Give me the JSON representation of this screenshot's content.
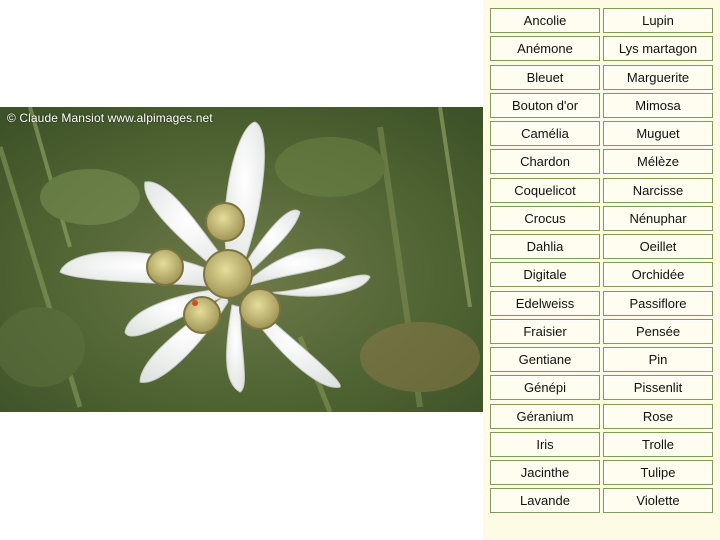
{
  "photo": {
    "credit": "© Claude Mansiot www.alpimages.net",
    "alt": "Edelweiss"
  },
  "flowers": [
    {
      "left": "Ancolie",
      "right": "Lupin"
    },
    {
      "left": "Anémone",
      "right": "Lys martagon"
    },
    {
      "left": "Bleuet",
      "right": "Marguerite"
    },
    {
      "left": "Bouton d'or",
      "right": "Mimosa"
    },
    {
      "left": "Camélia",
      "right": "Muguet"
    },
    {
      "left": "Chardon",
      "right": "Mélèze"
    },
    {
      "left": "Coquelicot",
      "right": "Narcisse"
    },
    {
      "left": "Crocus",
      "right": "Nénuphar"
    },
    {
      "left": "Dahlia",
      "right": "Oeillet"
    },
    {
      "left": "Digitale",
      "right": "Orchidée"
    },
    {
      "left": "Edelweiss",
      "right": "Passiflore"
    },
    {
      "left": "Fraisier",
      "right": "Pensée"
    },
    {
      "left": "Gentiane",
      "right": "Pin"
    },
    {
      "left": "Génépi",
      "right": "Pissenlit"
    },
    {
      "left": "Géranium",
      "right": "Rose"
    },
    {
      "left": "Iris",
      "right": "Trolle"
    },
    {
      "left": "Jacinthe",
      "right": "Tulipe"
    },
    {
      "left": "Lavande",
      "right": "Violette"
    }
  ]
}
